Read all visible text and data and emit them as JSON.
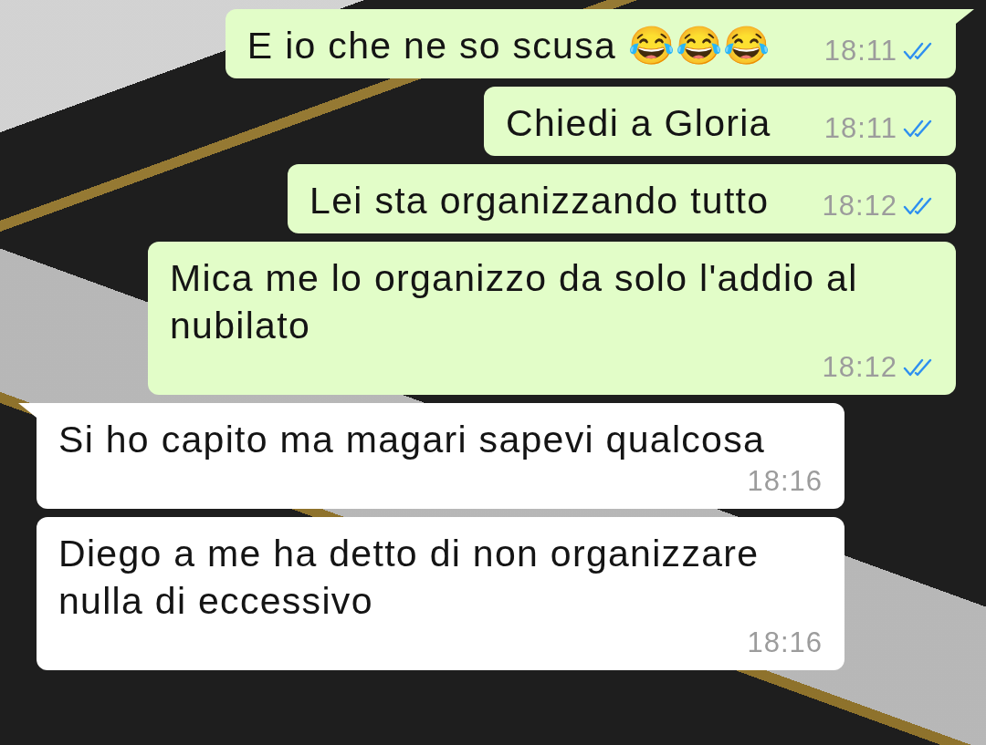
{
  "messages": [
    {
      "kind": "outgoing",
      "text": "E io che ne so scusa 😂😂😂",
      "time": "18:11",
      "read": true,
      "tail": true
    },
    {
      "kind": "outgoing",
      "text": "Chiedi a Gloria",
      "time": "18:11",
      "read": true,
      "tail": false
    },
    {
      "kind": "outgoing",
      "text": "Lei sta organizzando tutto",
      "time": "18:12",
      "read": true,
      "tail": false
    },
    {
      "kind": "outgoing",
      "text": "Mica me lo organizzo da solo l'addio al nubilato",
      "time": "18:12",
      "read": true,
      "tail": false
    },
    {
      "kind": "incoming",
      "text": "Si ho capito ma magari sapevi qualcosa",
      "time": "18:16",
      "tail": true
    },
    {
      "kind": "incoming",
      "text": "Diego a me ha detto di non organizzare nulla di eccessivo",
      "time": "18:16",
      "tail": false
    }
  ]
}
